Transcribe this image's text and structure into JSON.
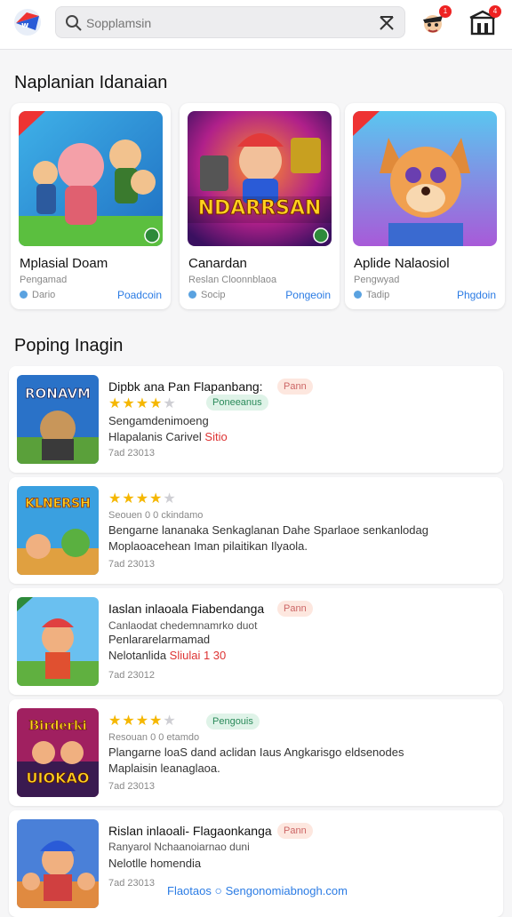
{
  "header": {
    "search_placeholder": "Sopplamsin",
    "notification_count": "1",
    "store_badge_count": "4"
  },
  "featured": {
    "title": "Naplanian Idanaian",
    "cards": [
      {
        "title": "Mplasial Doam",
        "subtitle": "Pengamad",
        "meta": "Dario",
        "link": "Poadcoin"
      },
      {
        "title": "Canardan",
        "subtitle": "Reslan Cloonnblaoa",
        "meta": "Socip",
        "link": "Pongeoin"
      },
      {
        "title": "Aplide Nalaosiol",
        "subtitle": "Pengwyad",
        "meta": "Tadip",
        "link": "Phgdoin"
      }
    ],
    "card2_art_text": "NDARRSAN"
  },
  "popular": {
    "title": "Poping Inagin",
    "items": [
      {
        "title": "Dipbk ana Pan Flapanbang:",
        "tag": "Pann",
        "tag2": "Poneeanus",
        "rating": 4,
        "line1": "Sengamdenimoeng",
        "line2_a": "Hlapalanis Carivel",
        "line2_b": "Sitio",
        "date": "7ad 23013",
        "art_text": "RONAVM"
      },
      {
        "title": "",
        "rating": 4,
        "small": "Seouen 0 0 ckindamo",
        "line1": "Bengarne lananaka Senkaglanan Dahe Sparlaoe senkanlodag",
        "line2": "Moplaoacehean Iman pilaitikan Ilyaola.",
        "date": "7ad 23013",
        "art_text": "KLNERSH"
      },
      {
        "title": "Iaslan inlaoala Fiabendanga",
        "tag": "Pann",
        "line1": "Canlaodat chedemnamrko duot",
        "line2": "Penlararelarmamad",
        "line3_a": "Nelotanlida",
        "line3_b": "Sliulai 1 30",
        "date": "7ad 23012",
        "art_text": ""
      },
      {
        "title": "",
        "rating": 4,
        "tag": "Pengouis",
        "small": "Resouan 0 0 etamdo",
        "line1": "Plangarne loaS dand aclidan Iaus Angkarisgo eldsenodes",
        "line2": "Maplaisin leanaglaoa.",
        "date": "7ad 23013",
        "art_text": "UIOKAO",
        "art_text_top": "Birderki"
      },
      {
        "title": "Rislan inlaoali- Flagaonkanga",
        "tag": "Pann",
        "line1": "Ranyarol Nchaanoiarnao duni",
        "line2": "Nelotlle homendia",
        "date": "7ad 23013",
        "art_text": ""
      }
    ]
  },
  "footer": {
    "link_a": "Flaotaos",
    "link_b": "Sengonomiabnogh.com"
  },
  "colors": {
    "accent_blue": "#2a7be4",
    "star_gold": "#f5b700",
    "tag_peach_bg": "#fde7df",
    "tag_green_bg": "#dff3e8"
  }
}
